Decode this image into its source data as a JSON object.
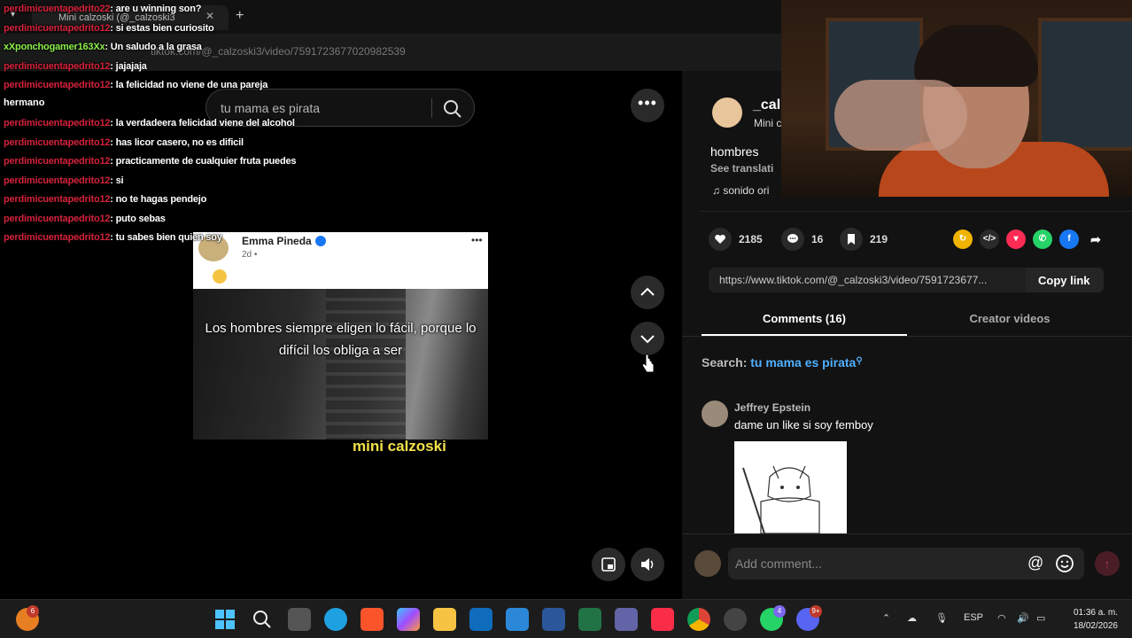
{
  "browser": {
    "tab_title": "Mini calzoski (@_calzoski3",
    "url": "tiktok.com/@_calzoski3/video/7591723677020982539"
  },
  "tiktok": {
    "search_query": "tu mama es pirata",
    "video": {
      "post_author": "Emma Pineda",
      "post_time": "2d •",
      "caption": "Los hombres siempre eligen lo fácil, porque lo difícil los obliga a ser",
      "watermark": "mini calzoski"
    },
    "author": {
      "name": "_cal",
      "sub": "Mini c",
      "description": "hombres",
      "see_translation": "See translati",
      "sound": "sonido ori"
    },
    "stats": {
      "likes": "2185",
      "comments": "16",
      "saves": "219"
    },
    "link": "https://www.tiktok.com/@_calzoski3/video/7591723677...",
    "copy_link": "Copy link",
    "tabs": {
      "comments": "Comments (16)",
      "creator": "Creator videos"
    },
    "search_label": "Search:",
    "search_term": "tu mama es pirata",
    "comment": {
      "author": "Jeffrey Epstein",
      "text": "dame un like si soy femboy"
    },
    "add_comment_placeholder": "Add comment..."
  },
  "chat": [
    {
      "user": "perdimicuentapedrito22",
      "msg": ": are u winning son?",
      "color": "red"
    },
    {
      "user": "perdimicuentapedrito12",
      "msg": ": si estas bien curiosito",
      "color": "red"
    },
    {
      "user": "xXponchogamer163Xx",
      "msg": ": Un saludo a la grasa",
      "color": "green"
    },
    {
      "user": "perdimicuentapedrito12",
      "msg": ": jajajaja",
      "color": "red"
    },
    {
      "user": "perdimicuentapedrito12",
      "msg": ": la felicidad no viene de una pareja",
      "color": "red"
    },
    {
      "user": "",
      "msg": "",
      "color": "red"
    },
    {
      "user": "perdimicuentapedrito12",
      "msg": ": la verdadeera felicidad viene del alcohol",
      "color": "red"
    },
    {
      "user": "perdimicuentapedrito12",
      "msg": ": has licor casero, no es dificil",
      "color": "red"
    },
    {
      "user": "perdimicuentapedrito12",
      "msg": ": practicamente de cualquier fruta puedes",
      "color": "red"
    },
    {
      "user": "perdimicuentapedrito12",
      "msg": ": si",
      "color": "red"
    },
    {
      "user": "perdimicuentapedrito12",
      "msg": ": no te hagas pendejo",
      "color": "red"
    },
    {
      "user": "perdimicuentapedrito12",
      "msg": ": puto sebas",
      "color": "red"
    },
    {
      "user": "perdimicuentapedrito12",
      "msg": ": tu sabes bien quien soy",
      "color": "red"
    }
  ],
  "chat_wrap": "hermano",
  "taskbar": {
    "lang": "ESP",
    "time": "01:36 a. m.",
    "date": "18/02/2026",
    "badge_left": "6",
    "badge_teams": "4",
    "badge_discord": "9+"
  }
}
